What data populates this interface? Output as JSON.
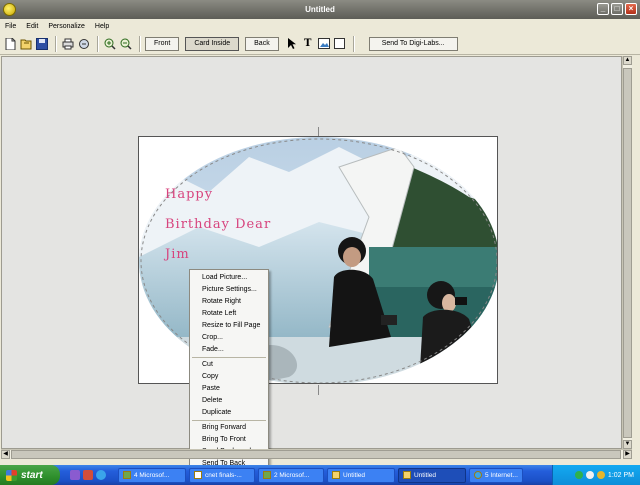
{
  "window": {
    "title": "Untitled",
    "minimize_label": "_",
    "maximize_label": "□",
    "close_label": "×"
  },
  "menu": [
    "File",
    "Edit",
    "Personalize",
    "Help"
  ],
  "toolbar": {
    "front_label": "Front",
    "card_inside_label": "Card Inside",
    "back_label": "Back",
    "send_label": "Send To Digi-Labs...",
    "text_tool_label": "T"
  },
  "card": {
    "lines": [
      "Happy",
      "Birthday Dear",
      "Jim"
    ],
    "text_color": "#d7447e"
  },
  "context_menu": {
    "group1": [
      "Load Picture...",
      "Picture Settings...",
      "Rotate Right",
      "Rotate Left",
      "Resize to Fill Page",
      "Crop...",
      "Fade..."
    ],
    "group2": [
      "Cut",
      "Copy",
      "Paste",
      "Delete",
      "Duplicate"
    ],
    "group3": [
      "Bring Forward",
      "Bring To Front",
      "Send Backward",
      "Send To Back"
    ]
  },
  "taskbar": {
    "start_label": "start",
    "tasks": [
      "4 Microsof...",
      "cnet finals-...",
      "2 Microsof...",
      "Untitled",
      "Untitled",
      "5 Internet..."
    ],
    "active_task": 4,
    "clock": "1:02 PM"
  }
}
